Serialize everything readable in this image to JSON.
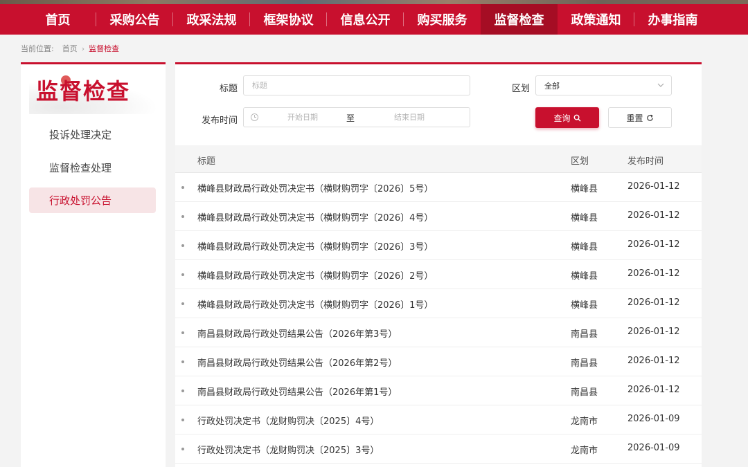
{
  "nav": {
    "items": [
      {
        "label": "首页"
      },
      {
        "label": "采购公告"
      },
      {
        "label": "政采法规"
      },
      {
        "label": "框架协议"
      },
      {
        "label": "信息公开"
      },
      {
        "label": "购买服务"
      },
      {
        "label": "监督检查",
        "active": true
      },
      {
        "label": "政策通知"
      },
      {
        "label": "办事指南"
      }
    ]
  },
  "breadcrumb": {
    "prefix": "当前位置:",
    "home": "首页",
    "current": "监督检查"
  },
  "sidebar": {
    "title": "监督检查",
    "items": [
      {
        "label": "投诉处理决定"
      },
      {
        "label": "监督检查处理"
      },
      {
        "label": "行政处罚公告",
        "active": true
      }
    ]
  },
  "filters": {
    "title_label": "标题",
    "title_placeholder": "标题",
    "region_label": "区划",
    "region_value": "全部",
    "date_label": "发布时间",
    "start_placeholder": "开始日期",
    "to": "至",
    "end_placeholder": "结束日期",
    "query_label": "查询",
    "reset_label": "重置"
  },
  "table": {
    "headers": {
      "title": "标题",
      "region": "区划",
      "date": "发布时间"
    },
    "rows": [
      {
        "title": "横峰县财政局行政处罚决定书（横财购罚字〔2026〕5号）",
        "region": "横峰县",
        "date": "2026-01-12"
      },
      {
        "title": "横峰县财政局行政处罚决定书（横财购罚字〔2026〕4号）",
        "region": "横峰县",
        "date": "2026-01-12"
      },
      {
        "title": "横峰县财政局行政处罚决定书（横财购罚字〔2026〕3号）",
        "region": "横峰县",
        "date": "2026-01-12"
      },
      {
        "title": "横峰县财政局行政处罚决定书（横财购罚字〔2026〕2号）",
        "region": "横峰县",
        "date": "2026-01-12"
      },
      {
        "title": "横峰县财政局行政处罚决定书（横财购罚字〔2026〕1号）",
        "region": "横峰县",
        "date": "2026-01-12"
      },
      {
        "title": "南昌县财政局行政处罚结果公告（2026年第3号）",
        "region": "南昌县",
        "date": "2026-01-12"
      },
      {
        "title": "南昌县财政局行政处罚结果公告（2026年第2号）",
        "region": "南昌县",
        "date": "2026-01-12"
      },
      {
        "title": "南昌县财政局行政处罚结果公告（2026年第1号）",
        "region": "南昌县",
        "date": "2026-01-12"
      },
      {
        "title": "行政处罚决定书（龙财购罚决〔2025〕4号）",
        "region": "龙南市",
        "date": "2026-01-09"
      },
      {
        "title": "行政处罚决定书（龙财购罚决〔2025〕3号）",
        "region": "龙南市",
        "date": "2026-01-09"
      }
    ]
  },
  "colors": {
    "brand": "#c8102e"
  }
}
